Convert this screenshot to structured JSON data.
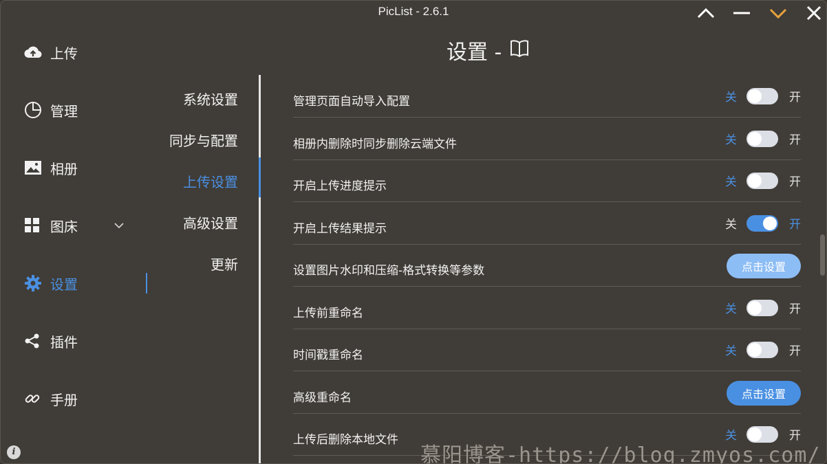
{
  "app": {
    "title": "PicList - 2.6.1"
  },
  "nav": {
    "items": [
      {
        "label": "上传",
        "icon": "upload-cloud-icon"
      },
      {
        "label": "管理",
        "icon": "pie-chart-icon"
      },
      {
        "label": "相册",
        "icon": "image-icon"
      },
      {
        "label": "图床",
        "icon": "grid-icon"
      },
      {
        "label": "设置",
        "icon": "gear-icon"
      },
      {
        "label": "插件",
        "icon": "share-icon"
      },
      {
        "label": "手册",
        "icon": "link-icon"
      }
    ],
    "active": "设置"
  },
  "page": {
    "title": "设置 -"
  },
  "submenu": {
    "items": [
      "系统设置",
      "同步与配置",
      "上传设置",
      "高级设置",
      "更新"
    ],
    "active": "上传设置"
  },
  "switch_labels": {
    "off": "关",
    "on": "开"
  },
  "settings": [
    {
      "label": "管理页面自动导入配置",
      "type": "switch",
      "value": false
    },
    {
      "label": "相册内删除时同步删除云端文件",
      "type": "switch",
      "value": false
    },
    {
      "label": "开启上传进度提示",
      "type": "switch",
      "value": false
    },
    {
      "label": "开启上传结果提示",
      "type": "switch",
      "value": true
    },
    {
      "label": "设置图片水印和压缩-格式转换等参数",
      "type": "button",
      "button_label": "点击设置"
    },
    {
      "label": "上传前重命名",
      "type": "switch",
      "value": false
    },
    {
      "label": "时间戳重命名",
      "type": "switch",
      "value": false
    },
    {
      "label": "高级重命名",
      "type": "button",
      "button_label": "点击设置"
    },
    {
      "label": "上传后删除本地文件",
      "type": "switch",
      "value": false
    }
  ],
  "watermark": "慕阳博客-https://blog.zmyos.com/",
  "colors": {
    "accent": "#4a90e2",
    "background": "#403c37",
    "minimize_accent": "#e8a33d"
  }
}
